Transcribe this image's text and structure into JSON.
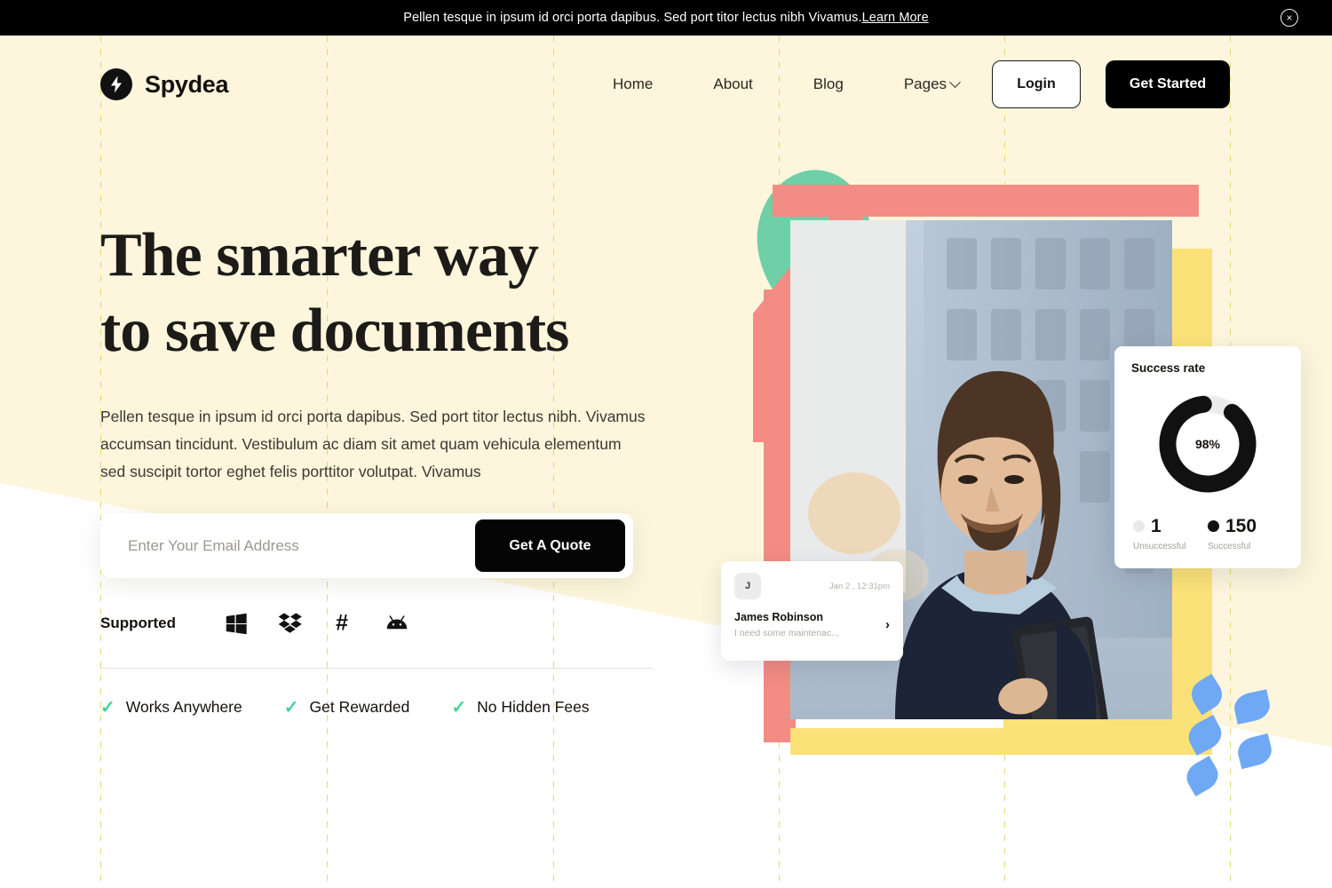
{
  "announcement": {
    "text": "Pellen tesque in ipsum id orci porta dapibus. Sed port titor lectus nibh Vivamus.",
    "link_label": "Learn More",
    "close_icon": "close-icon",
    "close_glyph": "×",
    "bg_color": "#000000",
    "text_color": "#ffffff"
  },
  "header": {
    "brand": {
      "name": "Spydea",
      "logo_icon": "bolt-icon"
    },
    "nav": [
      {
        "label": "Home"
      },
      {
        "label": "About"
      },
      {
        "label": "Blog"
      },
      {
        "label": "Pages",
        "has_chevron": true
      }
    ],
    "login_label": "Login",
    "get_started_label": "Get Started"
  },
  "hero": {
    "headline_line1": "The smarter way",
    "headline_line2": "to save documents",
    "body": "Pellen tesque in ipsum id orci porta dapibus. Sed port titor lectus nibh. Vivamus accumsan tincidunt. Vestibulum ac diam sit amet quam vehicula elementum sed suscipit tortor eghet felis porttitor volutpat. Vivamus",
    "email_placeholder": "Enter Your Email Address",
    "email_value": "",
    "quote_button_label": "Get A Quote",
    "supported_label": "Supported",
    "supported_icons": [
      {
        "name": "windows-icon"
      },
      {
        "name": "dropbox-icon"
      },
      {
        "name": "slack-hash-icon"
      },
      {
        "name": "android-icon"
      }
    ],
    "features": [
      {
        "label": "Works Anywhere",
        "check_glyph": "✓"
      },
      {
        "label": "Get Rewarded",
        "check_glyph": "✓"
      },
      {
        "label": "No Hidden Fees",
        "check_glyph": "✓"
      }
    ]
  },
  "success_card": {
    "title": "Success rate",
    "percent_label": "98%",
    "legend": [
      {
        "value": "1",
        "caption": "Unsuccessful",
        "color": "#e9e9e9"
      },
      {
        "value": "150",
        "caption": "Successful",
        "color": "#111111"
      }
    ]
  },
  "message_card": {
    "avatar_initial": "J",
    "timestamp": "Jan 2 , 12:31pm",
    "name": "James Robinson",
    "preview": "I need some maintenac...",
    "chevron_glyph": "›"
  },
  "chart_data": {
    "type": "pie",
    "title": "Success rate",
    "categories": [
      "Successful",
      "Unsuccessful"
    ],
    "values": [
      150,
      1
    ],
    "percent": 98,
    "colors": [
      "#111111",
      "#e9e9e9"
    ],
    "legend_position": "bottom"
  },
  "theme": {
    "cream": "#FDF6DC",
    "black": "#000000",
    "salmon": "#F38C84",
    "green": "#6FCFA6",
    "yellow": "#FBE278",
    "blue": "#6FA8F5",
    "check_green": "#3ED598",
    "guide": "#E8C84E"
  }
}
